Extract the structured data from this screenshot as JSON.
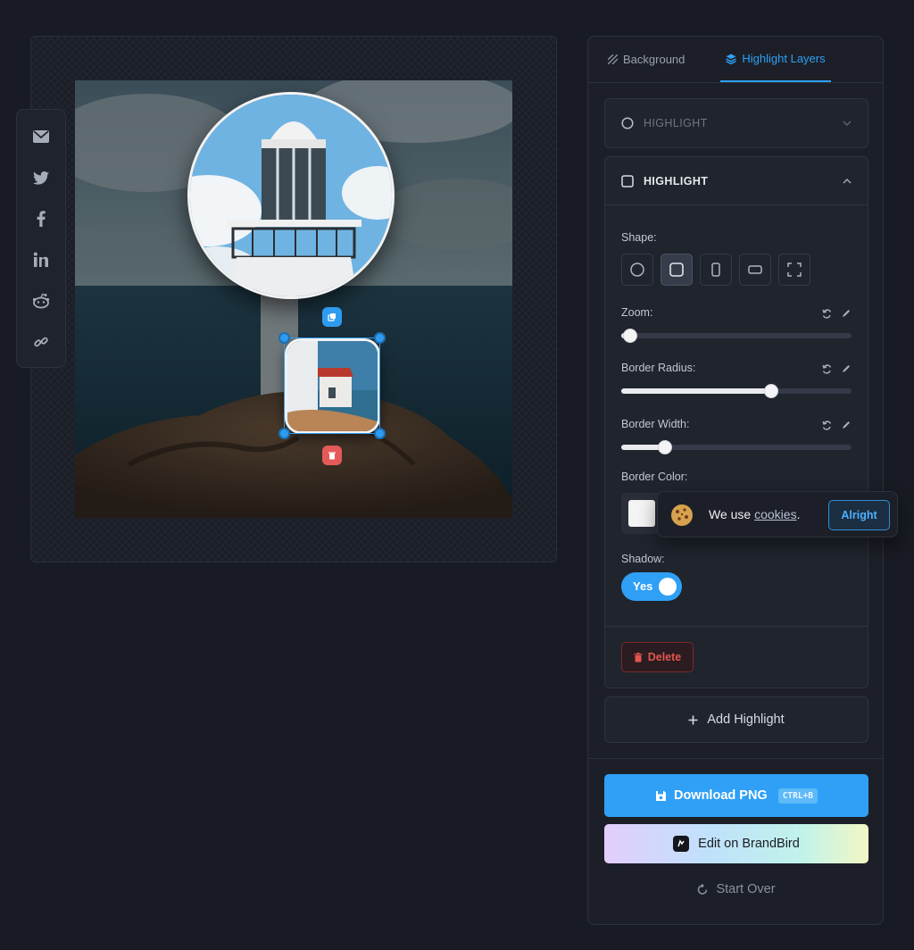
{
  "tabs": [
    {
      "label": "Background",
      "icon": "pattern-icon",
      "active": false
    },
    {
      "label": "Highlight Layers",
      "icon": "layers-icon",
      "active": true
    }
  ],
  "highlight_collapsed": {
    "label": "HIGHLIGHT",
    "shape_icon": "circle-icon"
  },
  "highlight_expanded": {
    "label": "HIGHLIGHT",
    "shape_icon": "square-icon",
    "shape_label": "Shape:",
    "shapes": [
      "circle",
      "rounded-square",
      "portrait",
      "landscape",
      "fullscreen"
    ],
    "selected_shape": "rounded-square",
    "zoom": {
      "label": "Zoom:",
      "value": 0.04
    },
    "border_radius": {
      "label": "Border Radius:",
      "value": 0.65
    },
    "border_width": {
      "label": "Border Width:",
      "value": 0.19
    },
    "border_color": {
      "label": "Border Color:",
      "value": "#f4f4f4"
    },
    "shadow": {
      "label": "Shadow:",
      "toggle_text": "Yes",
      "enabled": true
    },
    "delete_label": "Delete"
  },
  "add_highlight_label": "Add Highlight",
  "download": {
    "label": "Download PNG",
    "shortcut": "CTRL+B"
  },
  "brandbird_label": "Edit on BrandBird",
  "start_over_label": "Start Over",
  "cookie": {
    "prefix": "We use ",
    "link": "cookies",
    "suffix": ".",
    "button": "Alright"
  },
  "share_icons": [
    "mail-icon",
    "twitter-icon",
    "facebook-icon",
    "linkedin-icon",
    "reddit-icon",
    "link-icon"
  ],
  "colors": {
    "accent": "#2fa0f5",
    "danger": "#e2554f",
    "background": "#181b23"
  }
}
